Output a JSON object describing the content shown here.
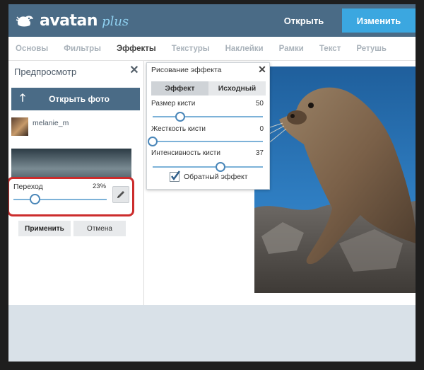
{
  "app": {
    "logo_text": "avatan",
    "logo_suffix": "plus",
    "open_button": "Открыть",
    "change_button": "Изменить"
  },
  "tabs": [
    {
      "label": "Основы",
      "active": false
    },
    {
      "label": "Фильтры",
      "active": false
    },
    {
      "label": "Эффекты",
      "active": true
    },
    {
      "label": "Текстуры",
      "active": false
    },
    {
      "label": "Наклейки",
      "active": false
    },
    {
      "label": "Рамки",
      "active": false
    },
    {
      "label": "Текст",
      "active": false
    },
    {
      "label": "Ретушь",
      "active": false
    }
  ],
  "left_panel": {
    "title": "Предпросмотр",
    "open_photo_label": "Открыть фото",
    "user_name": "melanie_m",
    "transition": {
      "label": "Переход",
      "value_text": "23%",
      "value": 23
    },
    "apply_label": "Применить",
    "cancel_label": "Отмена"
  },
  "dialog": {
    "title": "Рисование эффекта",
    "segments": [
      {
        "label": "Эффект",
        "active": true
      },
      {
        "label": "Исходный",
        "active": false
      }
    ],
    "sliders": [
      {
        "label": "Размер кисти",
        "value": 50,
        "max": 200
      },
      {
        "label": "Жесткость кисти",
        "value": 0,
        "max": 100
      },
      {
        "label": "Интенсивность кисти",
        "value": 37,
        "max": 60
      }
    ],
    "checkbox": {
      "label": "Обратный эффект",
      "checked": true
    }
  },
  "colors": {
    "header": "#4a6b86",
    "accent": "#3ba7e0",
    "highlight": "#cc2d2d",
    "footer": "#d9e1e8"
  }
}
